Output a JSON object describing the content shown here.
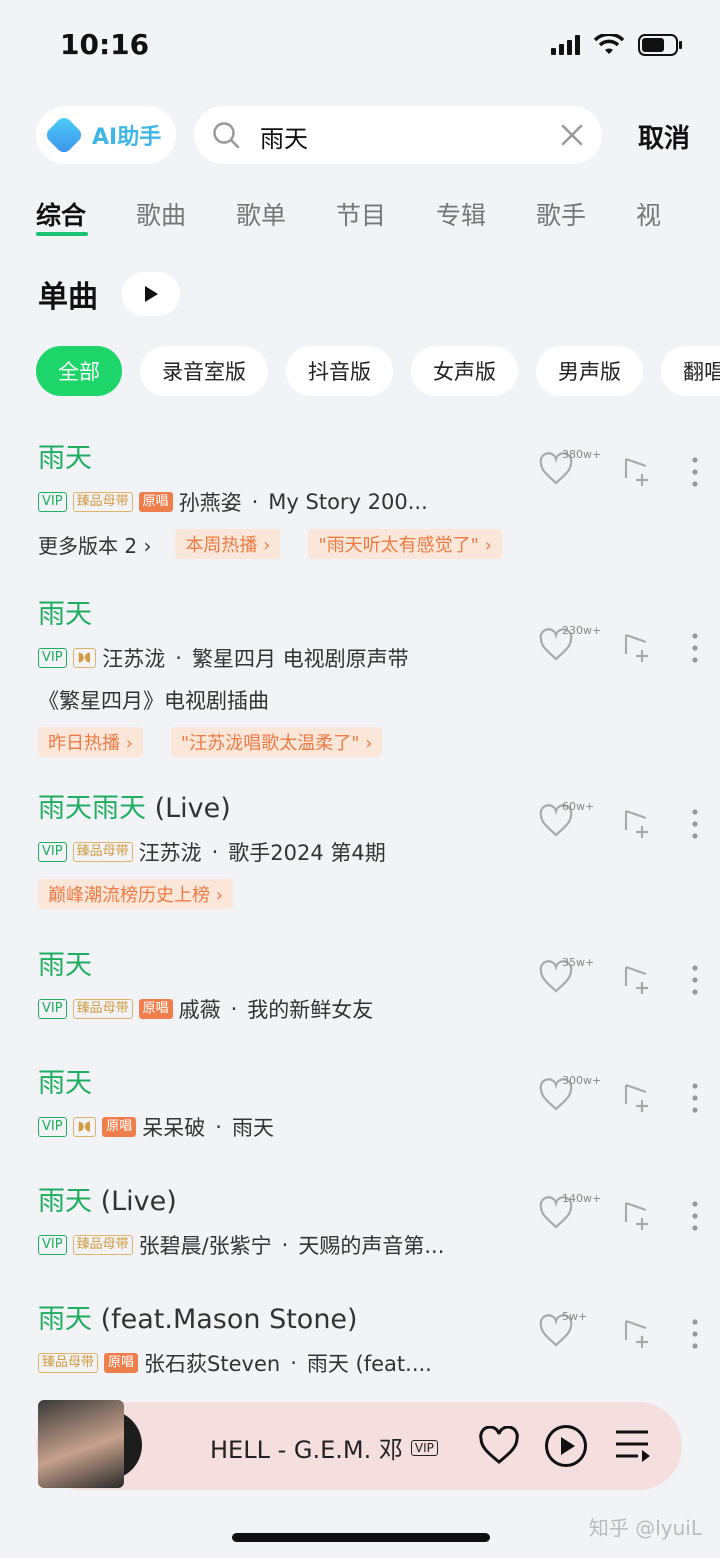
{
  "status": {
    "time": "10:16"
  },
  "search": {
    "ai_label": "AI助手",
    "query": "雨天",
    "cancel": "取消"
  },
  "tabs": [
    "综合",
    "歌曲",
    "歌单",
    "节目",
    "专辑",
    "歌手",
    "视"
  ],
  "section": {
    "title": "单曲"
  },
  "filters": [
    "全部",
    "录音室版",
    "抖音版",
    "女声版",
    "男声版",
    "翻唱"
  ],
  "songs": [
    {
      "title": "雨天",
      "suffix": "",
      "tags": [
        "VIP",
        "臻品母带",
        "原唱"
      ],
      "artist": "孙燕姿",
      "album": "My Story 200...",
      "more": "更多版本 2 ›",
      "hot": [
        "本周热播 ›",
        "\"雨天听太有感觉了\" ›"
      ],
      "likes": "380w+"
    },
    {
      "title": "雨天",
      "suffix": "",
      "tags": [
        "VIP",
        "dolby"
      ],
      "artist": "汪苏泷",
      "album": "繁星四月 电视剧原声带",
      "desc": "《繁星四月》电视剧插曲",
      "hot": [
        "昨日热播 ›",
        "\"汪苏泷唱歌太温柔了\" ›"
      ],
      "likes": "230w+"
    },
    {
      "title": "雨天雨天",
      "suffix": " (Live)",
      "tags": [
        "VIP",
        "臻品母带"
      ],
      "artist": "汪苏泷",
      "album": "歌手2024 第4期",
      "hot": [
        "巅峰潮流榜历史上榜 ›"
      ],
      "likes": "60w+"
    },
    {
      "title": "雨天",
      "suffix": "",
      "tags": [
        "VIP",
        "臻品母带",
        "原唱"
      ],
      "artist": "戚薇",
      "album": "我的新鲜女友",
      "likes": "35w+"
    },
    {
      "title": "雨天",
      "suffix": "",
      "tags": [
        "VIP",
        "dolby",
        "原唱"
      ],
      "artist": "呆呆破",
      "album": "雨天",
      "likes": "300w+"
    },
    {
      "title": "雨天",
      "suffix": " (Live)",
      "tags": [
        "VIP",
        "臻品母带"
      ],
      "artist": "张碧晨/张紫宁",
      "album": "天赐的声音第...",
      "likes": "140w+"
    },
    {
      "title": "雨天",
      "suffix": " (feat.Mason Stone)",
      "tags": [
        "臻品母带",
        "原唱"
      ],
      "artist": "张石荻Steven",
      "album": "雨天 (feat....",
      "likes": "5w+"
    }
  ],
  "player": {
    "title": "HELL - G.E.M. 邓",
    "vip": "VIP"
  },
  "watermark": "知乎 @lyuiL",
  "colors": {
    "accent": "#1fae60",
    "chip_active": "#1ed56a",
    "hot_text": "#ec7c45"
  }
}
